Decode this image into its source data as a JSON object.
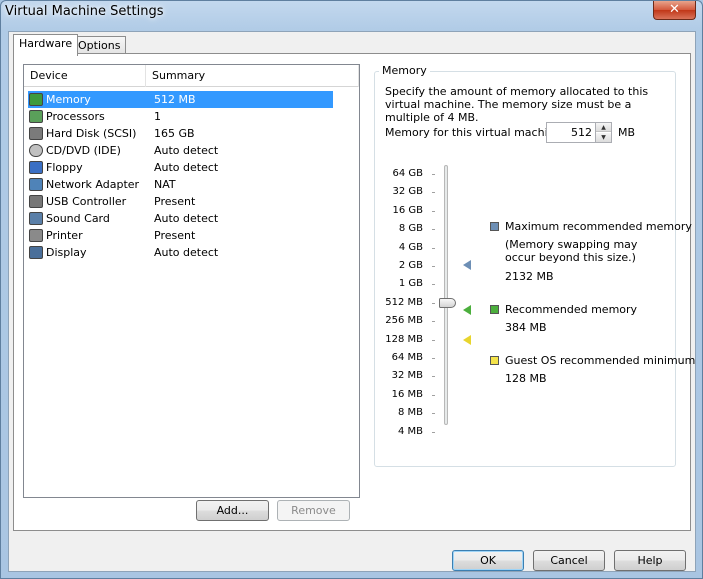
{
  "window": {
    "title": "Virtual Machine Settings",
    "close_glyph": "✕"
  },
  "tabs": [
    {
      "label": "Hardware",
      "active": true
    },
    {
      "label": "Options",
      "active": false
    }
  ],
  "device_list": {
    "columns": [
      "Device",
      "Summary"
    ],
    "rows": [
      {
        "device": "Memory",
        "summary": "512 MB",
        "icon": "memory-icon",
        "selected": true
      },
      {
        "device": "Processors",
        "summary": "1",
        "icon": "processor-icon"
      },
      {
        "device": "Hard Disk (SCSI)",
        "summary": "165 GB",
        "icon": "hard-disk-icon"
      },
      {
        "device": "CD/DVD (IDE)",
        "summary": "Auto detect",
        "icon": "cd-dvd-icon"
      },
      {
        "device": "Floppy",
        "summary": "Auto detect",
        "icon": "floppy-icon"
      },
      {
        "device": "Network Adapter",
        "summary": "NAT",
        "icon": "network-adapter-icon"
      },
      {
        "device": "USB Controller",
        "summary": "Present",
        "icon": "usb-icon"
      },
      {
        "device": "Sound Card",
        "summary": "Auto detect",
        "icon": "sound-card-icon"
      },
      {
        "device": "Printer",
        "summary": "Present",
        "icon": "printer-icon"
      },
      {
        "device": "Display",
        "summary": "Auto detect",
        "icon": "display-icon"
      }
    ],
    "add_label": "Add...",
    "remove_label": "Remove"
  },
  "memory": {
    "group_title": "Memory",
    "description": "Specify the amount of memory allocated to this virtual machine. The memory size must be a multiple of 4 MB.",
    "field_label": "Memory for this virtual machine:",
    "value": "512",
    "unit": "MB",
    "current_mb": 512,
    "scale": [
      "64 GB",
      "32 GB",
      "16 GB",
      "8 GB",
      "4 GB",
      "2 GB",
      "1 GB",
      "512 MB",
      "256 MB",
      "128 MB",
      "64 MB",
      "32 MB",
      "16 MB",
      "8 MB",
      "4 MB"
    ],
    "scale_mb": [
      65536,
      32768,
      16384,
      8192,
      4096,
      2048,
      1024,
      512,
      256,
      128,
      64,
      32,
      16,
      8,
      4
    ],
    "max_recommended": {
      "label": "Maximum recommended memory",
      "note_line1": "(Memory swapping may",
      "note_line2": "occur beyond this size.)",
      "value": "2132 MB",
      "mb": 2132,
      "color": "#6d8fb5"
    },
    "recommended": {
      "label": "Recommended memory",
      "value": "384 MB",
      "mb": 384,
      "color": "#4caf3d"
    },
    "guest_min": {
      "label": "Guest OS recommended minimum",
      "value": "128 MB",
      "mb": 128,
      "color": "#f4e34a"
    }
  },
  "footer": {
    "ok_label": "OK",
    "cancel_label": "Cancel",
    "help_label": "Help"
  }
}
